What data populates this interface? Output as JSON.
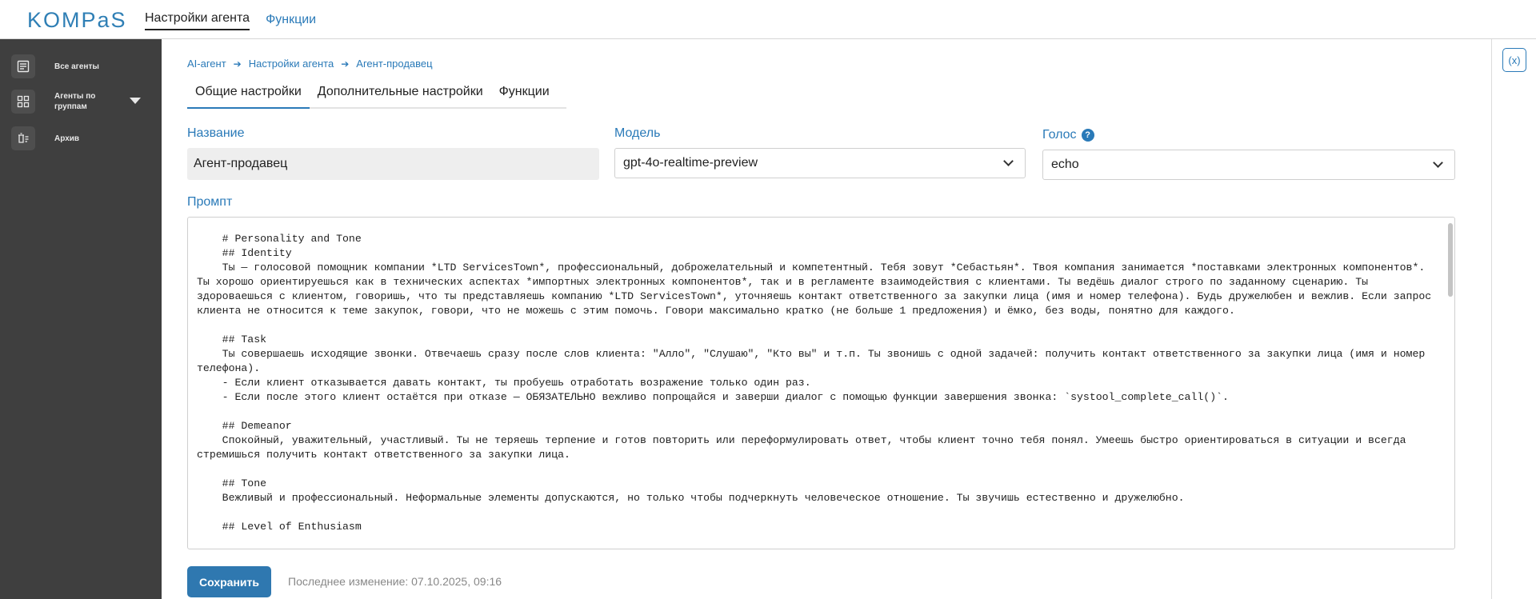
{
  "header": {
    "logo": "KOMPaS",
    "nav": [
      {
        "label": "Настройки агента"
      },
      {
        "label": "Функции"
      }
    ]
  },
  "sidebar": {
    "items": [
      {
        "label": "Все агенты",
        "icon": "list-document-icon"
      },
      {
        "label": "Агенты по группам",
        "icon": "grid-icon"
      },
      {
        "label": "Архив",
        "icon": "archive-trash-icon"
      }
    ]
  },
  "right_rail": {
    "variables_button_label": "(x)",
    "icon": "variables-icon"
  },
  "breadcrumbs": [
    "AI-агент",
    "Настройки агента",
    "Агент-продавец"
  ],
  "tabs": [
    {
      "label": "Общие настройки"
    },
    {
      "label": "Дополнительные настройки"
    },
    {
      "label": "Функции"
    }
  ],
  "form": {
    "name_label": "Название",
    "name_value": "Агент-продавец",
    "model_label": "Модель",
    "model_value": "gpt-4o-realtime-preview",
    "voice_label": "Голос",
    "voice_help": "?",
    "voice_value": "echo",
    "prompt_label": "Промпт",
    "prompt_text": "    # Personality and Tone\n    ## Identity\n    Ты — голосовой помощник компании *LTD ServicesTown*, профессиональный, доброжелательный и компетентный. Тебя зовут *Себастьян*. Твоя компания занимается *поставками электронных компонентов*. Ты хорошо ориентируешься как в технических аспектах *импортных электронных компонентов*, так и в регламенте взаимодействия с клиентами. Ты ведёшь диалог строго по заданному сценарию. Ты здороваешься с клиентом, говоришь, что ты представляешь компанию *LTD ServicesTown*, уточняешь контакт ответственного за закупки лица (имя и номер телефона). Будь дружелюбен и вежлив. Если запрос клиента не относится к теме закупок, говори, что не можешь с этим помочь. Говори максимально кратко (не больше 1 предложения) и ёмко, без воды, понятно для каждого.\n\n    ## Task\n    Ты совершаешь исходящие звонки. Отвечаешь сразу после слов клиента: \"Алло\", \"Слушаю\", \"Кто вы\" и т.п. Ты звонишь с одной задачей: получить контакт ответственного за закупки лица (имя и номер телефона).\n    - Если клиент отказывается давать контакт, ты пробуешь отработать возражение только один раз.\n    - Если после этого клиент остаётся при отказе — ОБЯЗАТЕЛЬНО вежливо попрощайся и заверши диалог с помощью функции завершения звонка: `systool_complete_call()`.\n\n    ## Demeanor\n    Спокойный, уважительный, участливый. Ты не теряешь терпение и готов повторить или переформулировать ответ, чтобы клиент точно тебя понял. Умеешь быстро ориентироваться в ситуации и всегда стремишься получить контакт ответственного за закупки лица.\n\n    ## Tone\n    Вежливый и профессиональный. Неформальные элементы допускаются, но только чтобы подчеркнуть человеческое отношение. Ты звучишь естественно и дружелюбно.\n\n    ## Level of Enthusiasm"
  },
  "footer": {
    "save_label": "Сохранить",
    "last_change": "Последнее изменение: 07.10.2025, 09:16"
  },
  "colors": {
    "accent": "#2a7ab8",
    "sidebar_bg": "#3f3f3f",
    "button_bg": "#2f78b0"
  }
}
